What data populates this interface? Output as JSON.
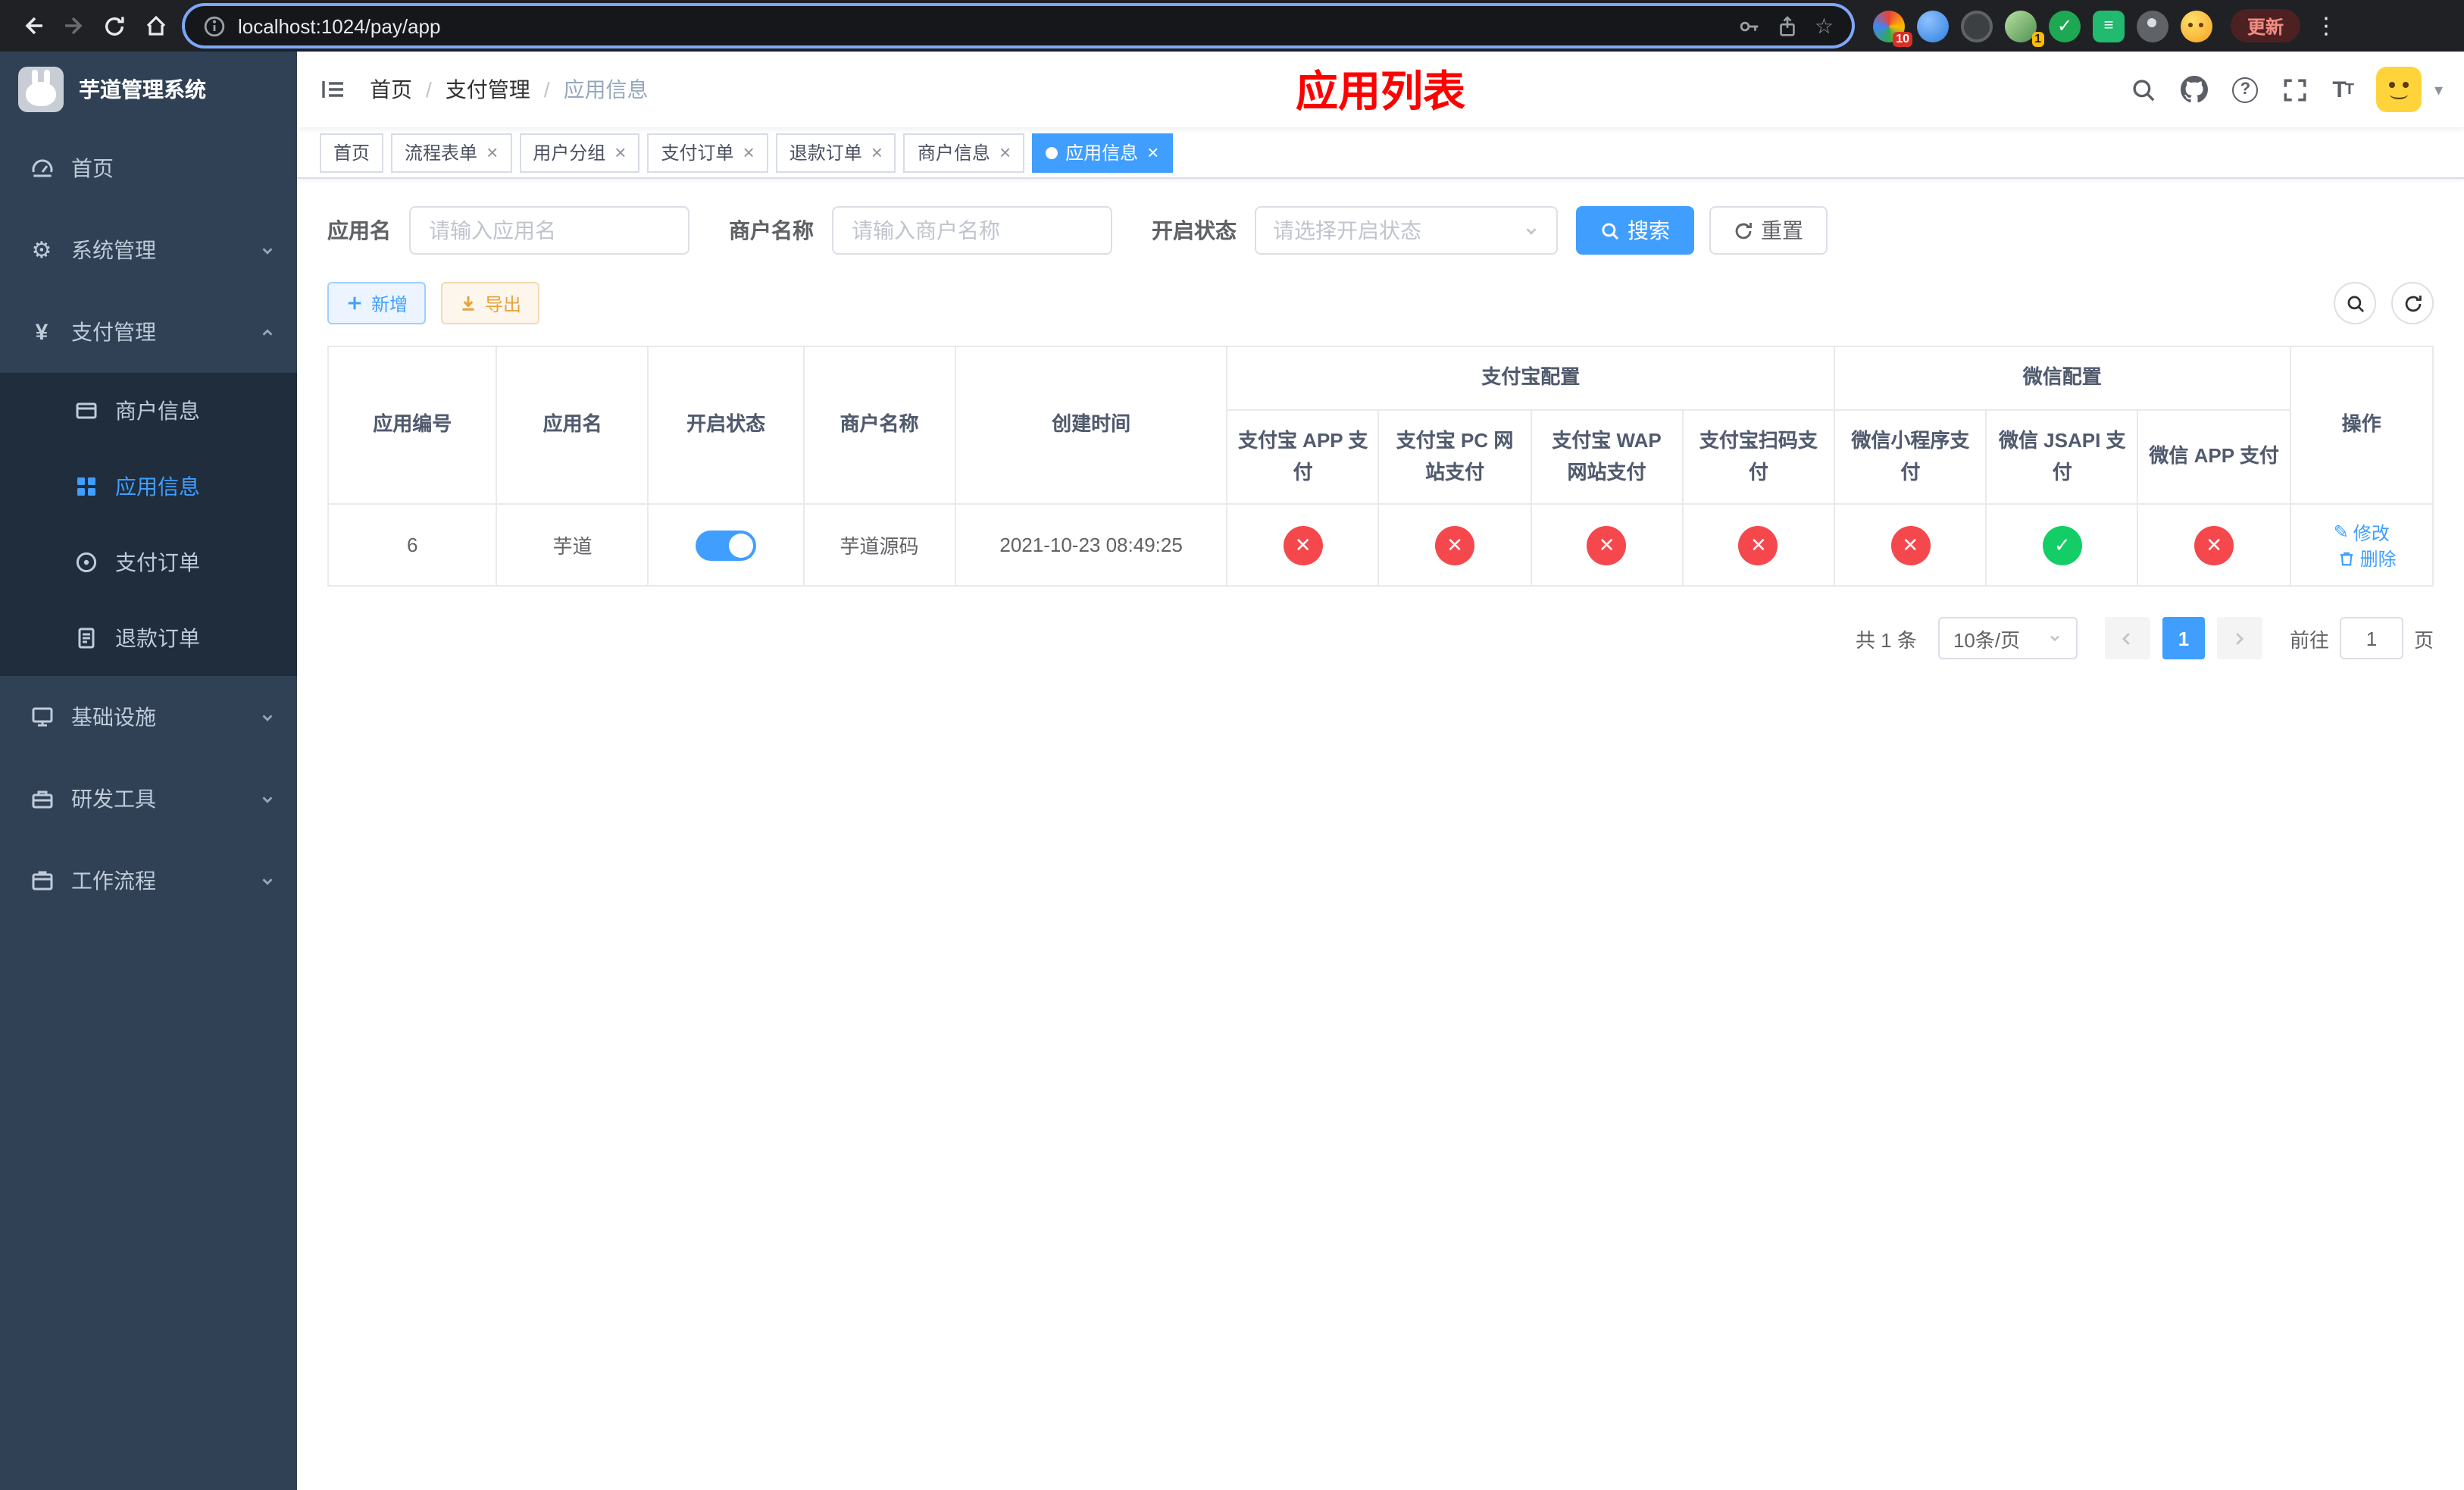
{
  "colors": {
    "primary": "#409eff",
    "success": "#13ce66",
    "danger": "#f5484d",
    "warning": "#e6a23c",
    "sidebar_bg": "#304156",
    "submenu_bg": "#1f2d3d",
    "title": "#ff0000"
  },
  "browser": {
    "url": "localhost:1024/pay/app",
    "update_button": "更新",
    "extension_badges": {
      "colorful": "10",
      "avatar": "1"
    }
  },
  "sidebar": {
    "app_title": "芋道管理系统",
    "menu": {
      "home": "首页",
      "system": "系统管理",
      "payment": "支付管理",
      "merchant_info": "商户信息",
      "app_info": "应用信息",
      "pay_order": "支付订单",
      "refund_order": "退款订单",
      "infrastructure": "基础设施",
      "dev_tools": "研发工具",
      "workflow": "工作流程"
    }
  },
  "navbar": {
    "breadcrumb": [
      "首页",
      "支付管理",
      "应用信息"
    ],
    "page_title": "应用列表"
  },
  "tabs": [
    {
      "label": "首页"
    },
    {
      "label": "流程表单"
    },
    {
      "label": "用户分组"
    },
    {
      "label": "支付订单"
    },
    {
      "label": "退款订单"
    },
    {
      "label": "商户信息"
    },
    {
      "label": "应用信息",
      "active": true
    }
  ],
  "filters": {
    "app_name_label": "应用名",
    "app_name_placeholder": "请输入应用名",
    "merchant_label": "商户名称",
    "merchant_placeholder": "请输入商户名称",
    "status_label": "开启状态",
    "status_placeholder": "请选择开启状态",
    "search_button": "搜索",
    "reset_button": "重置"
  },
  "toolbar": {
    "add_button": "新增",
    "export_button": "导出"
  },
  "table": {
    "headers": {
      "app_id": "应用编号",
      "app_name": "应用名",
      "status": "开启状态",
      "merchant": "商户名称",
      "created": "创建时间",
      "alipay_group": "支付宝配置",
      "wechat_group": "微信配置",
      "alipay_app": "支付宝 APP 支付",
      "alipay_pc": "支付宝 PC 网站支付",
      "alipay_wap": "支付宝 WAP 网站支付",
      "alipay_qr": "支付宝扫码支付",
      "wechat_mini": "微信小程序支付",
      "wechat_jsapi": "微信 JSAPI 支付",
      "wechat_app": "微信 APP 支付",
      "actions": "操作"
    },
    "rows": [
      {
        "app_id": "6",
        "app_name": "芋道",
        "enabled": true,
        "merchant": "芋道源码",
        "created": "2021-10-23 08:49:25",
        "alipay_app": false,
        "alipay_pc": false,
        "alipay_wap": false,
        "alipay_qr": false,
        "wechat_mini": false,
        "wechat_jsapi": true,
        "wechat_app": false,
        "edit": "修改",
        "delete": "删除"
      }
    ]
  },
  "pagination": {
    "total": "共 1 条",
    "page_size": "10条/页",
    "current_page": "1",
    "goto_label": "前往",
    "goto_value": "1",
    "goto_suffix": "页"
  },
  "icons": {
    "gear": "⚙",
    "yen": "¥",
    "star": "☆",
    "question": "?",
    "edit": "✎",
    "menu_dots": "⋮",
    "caret_down": "▾",
    "close": "×",
    "check_ext": "✓",
    "book_ext": "≡"
  }
}
